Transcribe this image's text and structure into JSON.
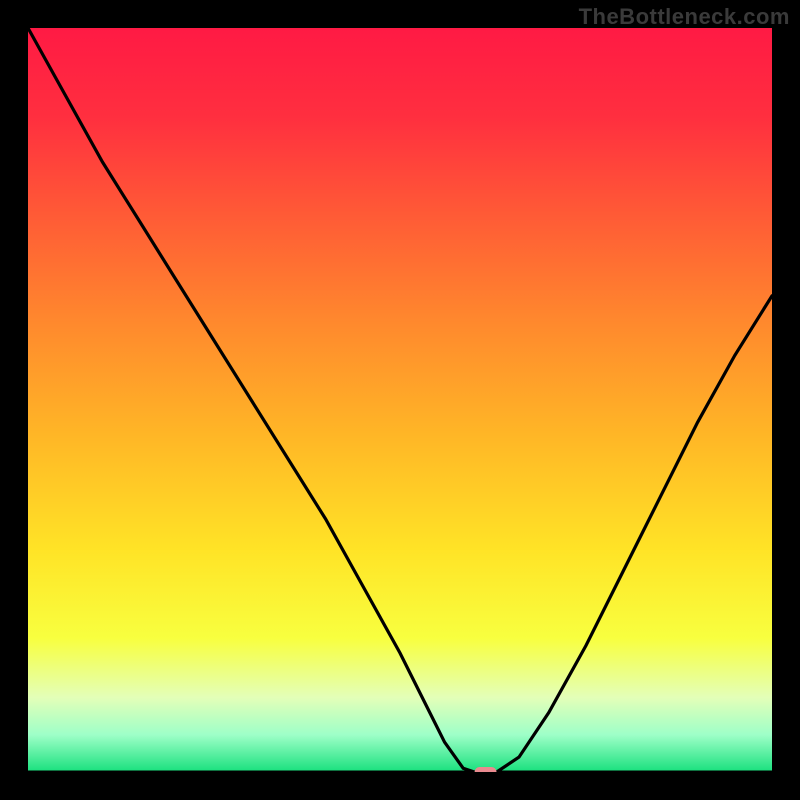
{
  "watermark": "TheBottleneck.com",
  "colors": {
    "page_bg": "#000000",
    "watermark": "#3a3a3a",
    "curve": "#000000",
    "baseline": "#000000",
    "marker_fill": "#e98a8f",
    "gradient_stops": [
      {
        "offset": 0.0,
        "color": "#ff1a44"
      },
      {
        "offset": 0.12,
        "color": "#ff2f3f"
      },
      {
        "offset": 0.25,
        "color": "#ff5a36"
      },
      {
        "offset": 0.4,
        "color": "#ff8a2d"
      },
      {
        "offset": 0.55,
        "color": "#ffb726"
      },
      {
        "offset": 0.7,
        "color": "#ffe326"
      },
      {
        "offset": 0.82,
        "color": "#f8ff3f"
      },
      {
        "offset": 0.9,
        "color": "#e3ffb8"
      },
      {
        "offset": 0.95,
        "color": "#9effc8"
      },
      {
        "offset": 1.0,
        "color": "#18e07d"
      }
    ]
  },
  "chart_data": {
    "type": "line",
    "title": "",
    "xlabel": "",
    "ylabel": "",
    "xlim": [
      0,
      100
    ],
    "ylim": [
      0,
      100
    ],
    "grid": false,
    "legend": false,
    "x": [
      0,
      5,
      10,
      15,
      20,
      25,
      30,
      35,
      40,
      45,
      50,
      53,
      56,
      58.5,
      60,
      63,
      66,
      70,
      75,
      80,
      85,
      90,
      95,
      100
    ],
    "values": [
      100,
      91,
      82,
      74,
      66,
      58,
      50,
      42,
      34,
      25,
      16,
      10,
      4,
      0.5,
      0,
      0,
      2,
      8,
      17,
      27,
      37,
      47,
      56,
      64
    ],
    "minimum_marker": {
      "x": 61.5,
      "y": 0
    },
    "note": "curve is a bottleneck-percentage style V shape; minimum near x≈61.5 at y≈0; values estimated from pixel positions"
  }
}
